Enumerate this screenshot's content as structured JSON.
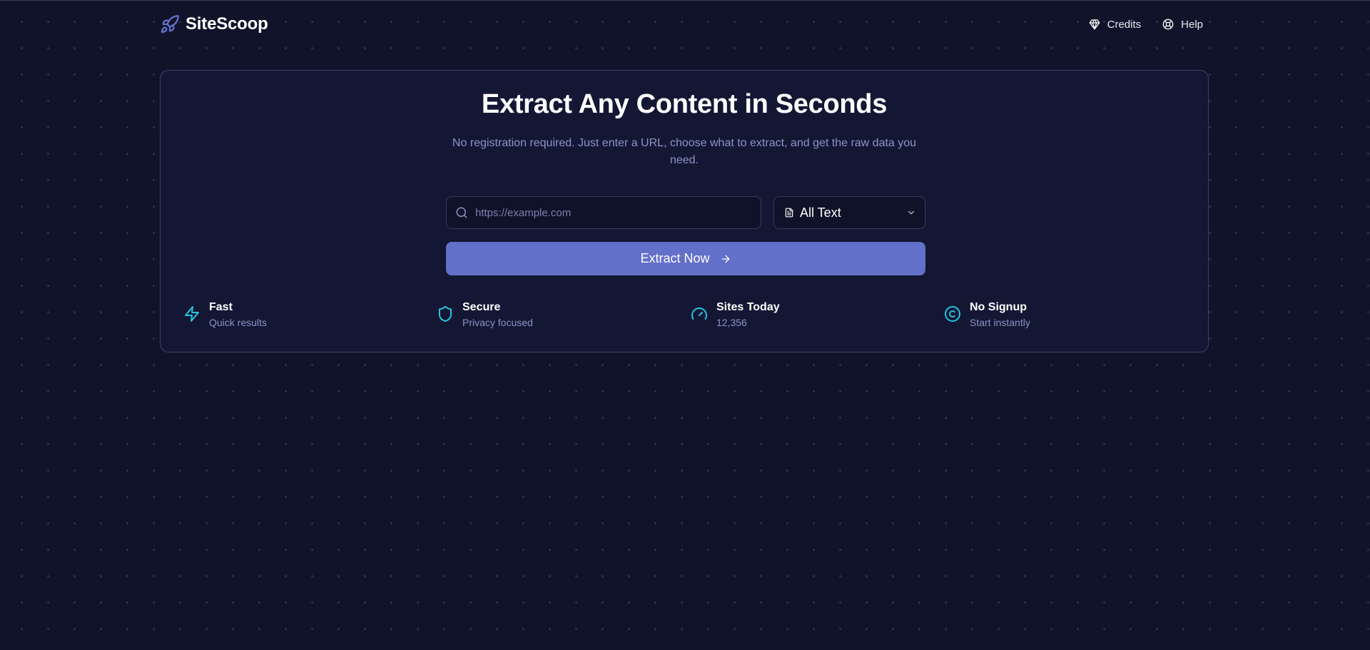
{
  "app": {
    "name": "SiteScoop"
  },
  "nav": {
    "credits": "Credits",
    "help": "Help"
  },
  "hero": {
    "title": "Extract Any Content in Seconds",
    "subtitle": "No registration required. Just enter a URL, choose what to extract, and get the raw data you need."
  },
  "form": {
    "url_placeholder": "https://example.com",
    "url_value": "",
    "extract_type": "All Text",
    "submit_label": "Extract Now"
  },
  "features": [
    {
      "icon": "lightning-icon",
      "title": "Fast",
      "subtitle": "Quick results"
    },
    {
      "icon": "shield-icon",
      "title": "Secure",
      "subtitle": "Privacy focused"
    },
    {
      "icon": "gauge-icon",
      "title": "Sites Today",
      "subtitle": "12,356"
    },
    {
      "icon": "copyright-icon",
      "title": "No Signup",
      "subtitle": "Start instantly"
    }
  ],
  "colors": {
    "background": "#11132a",
    "card": "#141734",
    "accent": "#6370c9",
    "feature_icon": "#22c5e0",
    "muted_text": "#8c93c6"
  }
}
